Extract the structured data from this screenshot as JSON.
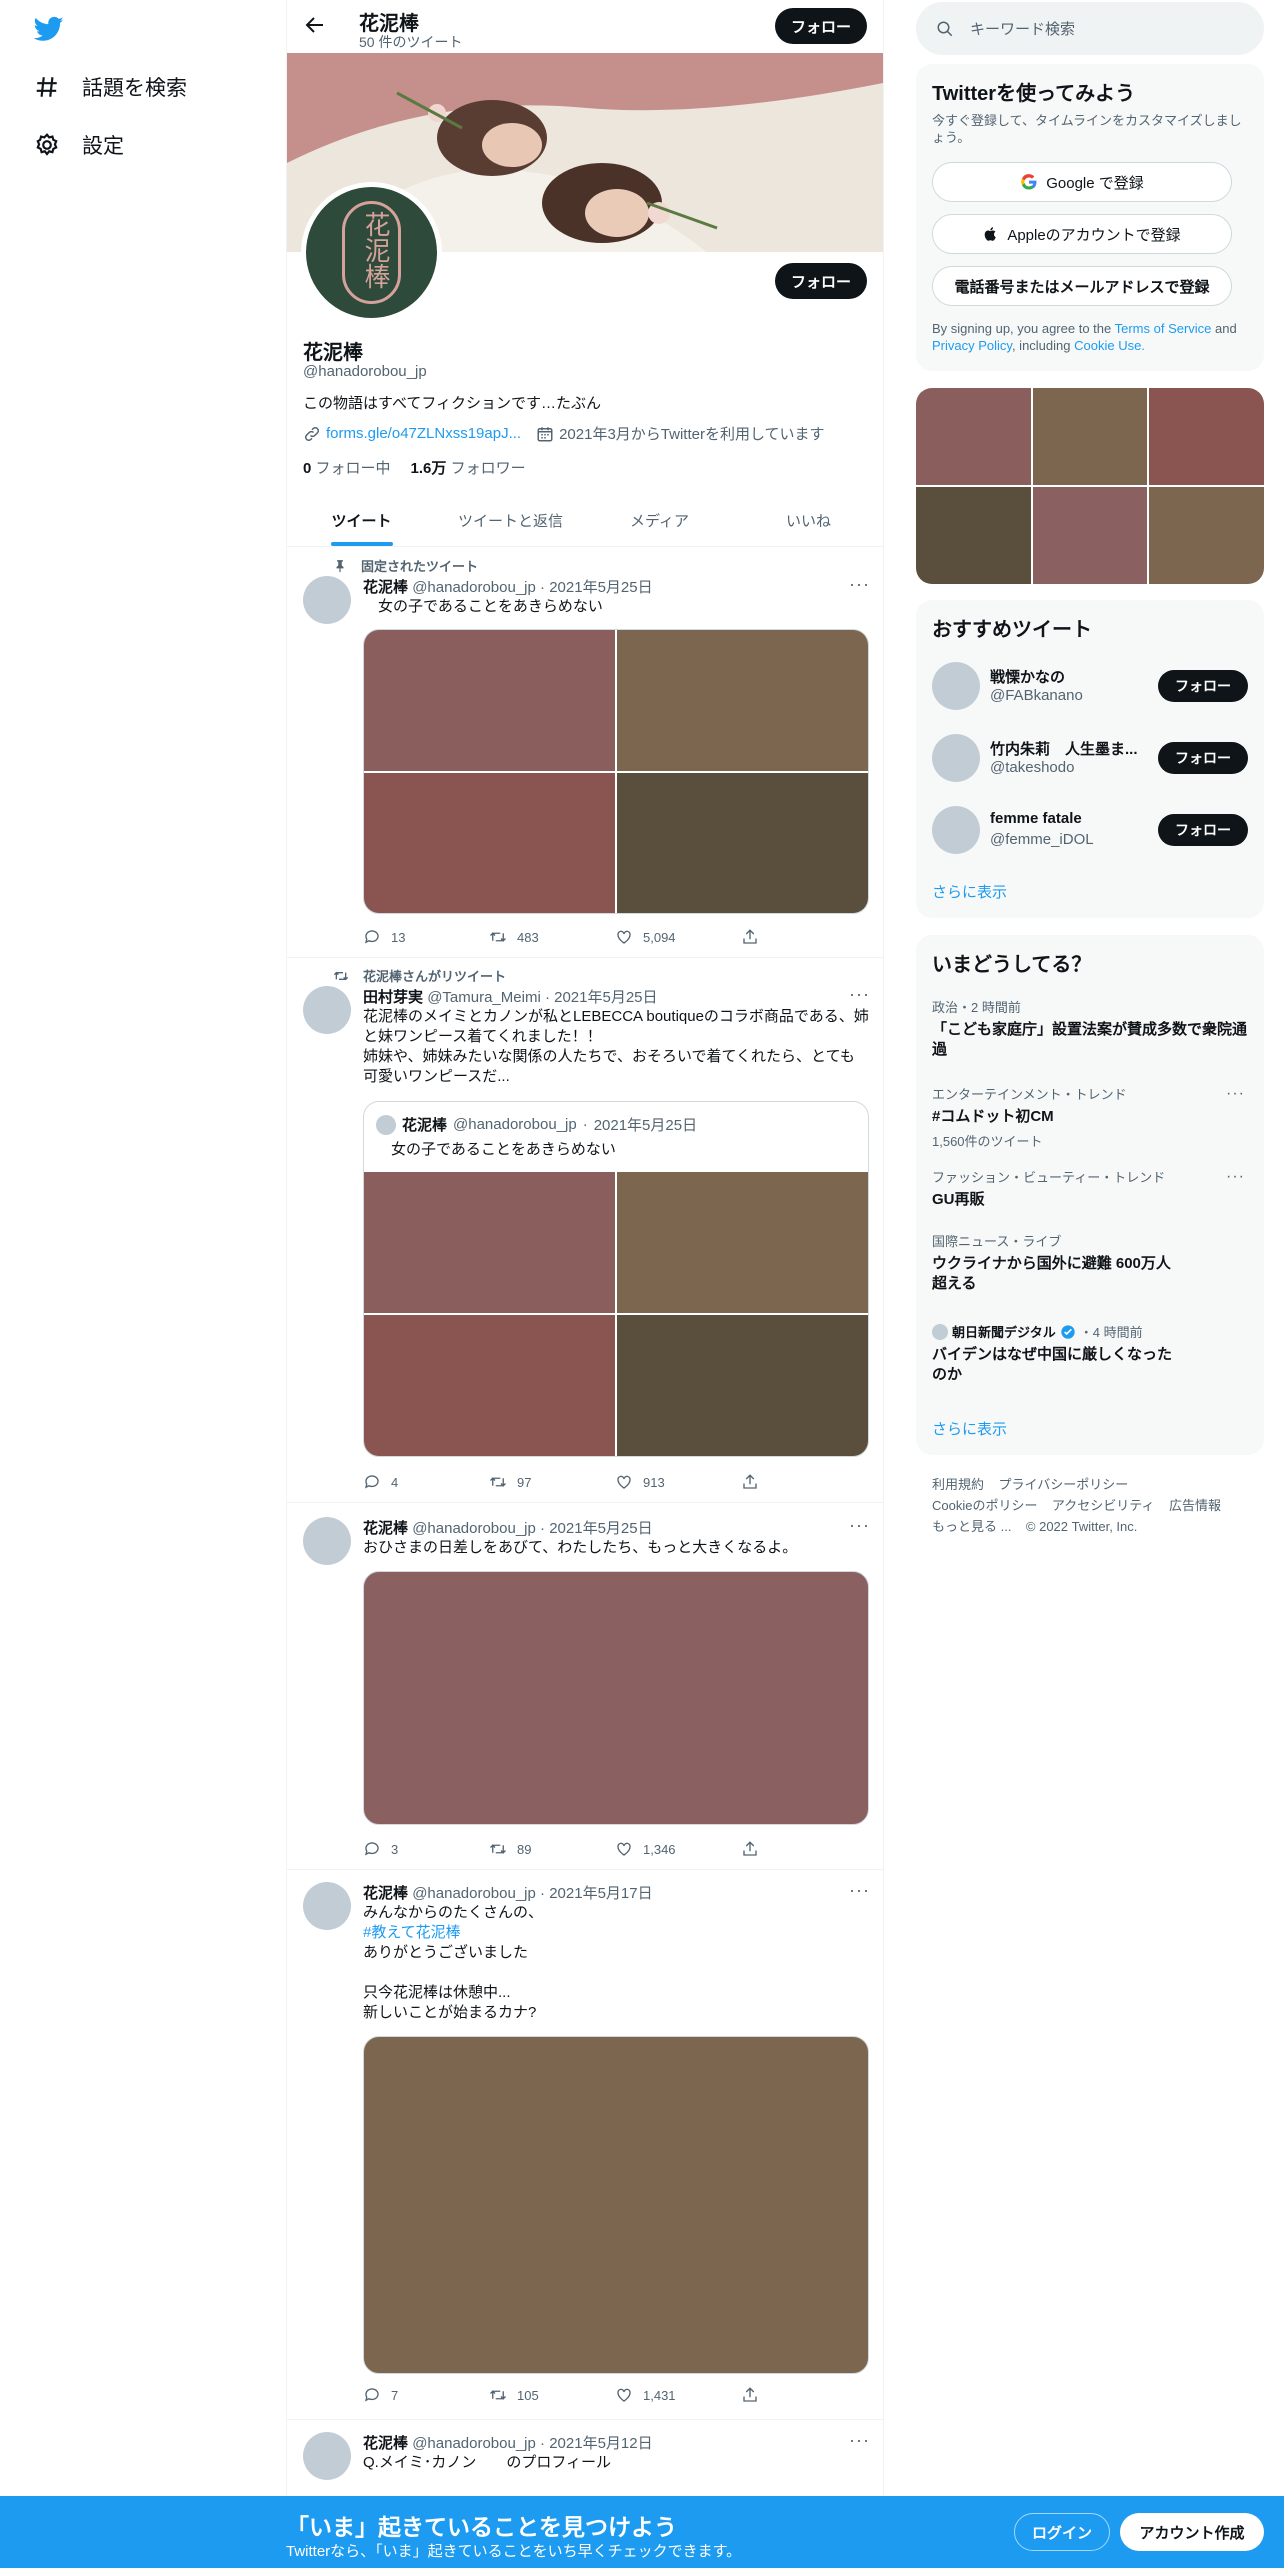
{
  "colors": {
    "accent": "#1d9bf0",
    "banner": "#c58f8b",
    "avatar_bg": "#2d4a3a"
  },
  "nav": {
    "logo": "twitter-bird-icon",
    "items": [
      {
        "label": "話題を検索",
        "icon": "hash-icon"
      },
      {
        "label": "設定",
        "icon": "gear-icon"
      }
    ]
  },
  "profile_header": {
    "name": "花泥棒",
    "tweet_count": "50 件のツイート",
    "follow_label": "フォロー"
  },
  "profile": {
    "avatar_text": "花泥棒",
    "follow_label": "フォロー",
    "name": "花泥棒",
    "handle": "@hanadorobou_jp",
    "bio": "この物語はすべてフィクションです…たぶん",
    "link": "forms.gle/o47ZLNxss19apJ...",
    "joined": "2021年3月からTwitterを利用しています",
    "following_count": "0",
    "following_label": "フォロー中",
    "followers_count": "1.6万",
    "followers_label": "フォロワー"
  },
  "tabs": [
    "ツイート",
    "ツイートと返信",
    "メディア",
    "いいね"
  ],
  "tweets": [
    {
      "context": "固定されたツイート",
      "name": "花泥棒",
      "handle": "@hanadorobou_jp",
      "date": "2021年5月25日",
      "text": "　女の子であることをあきらめない",
      "replies": "13",
      "retweets": "483",
      "likes": "5,094",
      "photos": [
        "#8b5e5e",
        "#7d6650",
        "#8a5550",
        "#5a4e3c"
      ]
    },
    {
      "context": "花泥棒さんがリツイート",
      "name": "田村芽実",
      "handle": "@Tamura_Meimi",
      "date": "2021年5月25日",
      "text": "花泥棒のメイミとカノンが私とLEBECCA boutiqueのコラボ商品である、姉と妹ワンピース着てくれました！！\n姉妹や、姉妹みたいな関係の人たちで、おそろいで着てくれたら、とても可愛いワンピースだ...",
      "quote": {
        "name": "花泥棒",
        "handle": "@hanadorobou_jp",
        "date": "2021年5月25日",
        "text": "　女の子であることをあきらめない"
      },
      "replies": "4",
      "retweets": "97",
      "likes": "913",
      "photos": [
        "#8b5e5e",
        "#7d6650",
        "#8a5550",
        "#5a4e3c"
      ]
    },
    {
      "name": "花泥棒",
      "handle": "@hanadorobou_jp",
      "date": "2021年5月25日",
      "text": "おひさまの日差しをあびて、わたしたち、もっと大きくなるよ。",
      "replies": "3",
      "retweets": "89",
      "likes": "1,346",
      "photos": [
        "#8a6060"
      ]
    },
    {
      "name": "花泥棒",
      "handle": "@hanadorobou_jp",
      "date": "2021年5月17日",
      "text_line1": "みんなからのたくさんの、",
      "hashtag": "#教えて花泥棒",
      "text_rest": "ありがとうございました\n\n只今花泥棒は休憩中...\n新しいことが始まるカナ?",
      "replies": "7",
      "retweets": "105",
      "likes": "1,431",
      "photos": [
        "#7d6650"
      ]
    },
    {
      "name": "花泥棒",
      "handle": "@hanadorobou_jp",
      "date": "2021年5月12日",
      "text": "Q.メイミ･カノン　　のプロフィール"
    }
  ],
  "search": {
    "placeholder": "キーワード検索"
  },
  "signup": {
    "title": "Twitterを使ってみよう",
    "subtitle": "今すぐ登録して、タイムラインをカスタマイズしましょう。",
    "google": "Google で登録",
    "apple": "Appleのアカウントで登録",
    "phone": "電話番号またはメールアドレスで登録",
    "terms_prefix": "By signing up, you agree to the ",
    "terms": "Terms of Service",
    "and": " and ",
    "privacy": "Privacy Policy",
    "including": ", including ",
    "cookie": "Cookie Use."
  },
  "media_grid": [
    "#8b5e5e",
    "#7d6650",
    "#8a5550",
    "#5a4e3c",
    "#8a6060",
    "#7d6650"
  ],
  "who_to_follow": {
    "title": "おすすめツイート",
    "users": [
      {
        "name": "戦慄かなの",
        "handle": "@FABkanano",
        "button": "フォロー"
      },
      {
        "name": "竹内朱莉　人生墨ま...",
        "handle": "@takeshodo",
        "button": "フォロー"
      },
      {
        "name": "femme fatale",
        "handle": "@femme_iDOL",
        "button": "フォロー"
      }
    ],
    "more": "さらに表示"
  },
  "trends": {
    "title": "いまどうしてる？",
    "items": [
      {
        "meta": "政治・2 時間前",
        "title": "「こども家庭庁」設置法案が賛成多数で衆院通過"
      },
      {
        "meta": "エンターテインメント・トレンド",
        "title": "#コムドット初CM",
        "count": "1,560件のツイート"
      },
      {
        "meta": "ファッション・ビューティー・トレンド",
        "title": "GU再販"
      },
      {
        "meta": "国際ニュース・ライブ",
        "title": "ウクライナから国外に避難 600万人超える"
      },
      {
        "source": "朝日新聞デジタル",
        "meta": "・4 時間前",
        "title": "バイデンはなぜ中国に厳しくなったのか"
      }
    ],
    "more": "さらに表示"
  },
  "footer": {
    "row1": [
      "利用規約",
      "プライバシーポリシー"
    ],
    "row2": [
      "Cookieのポリシー",
      "アクセシビリティ",
      "広告情報"
    ],
    "more": "もっと見る ...",
    "copyright": "© 2022 Twitter, Inc."
  },
  "bottom_bar": {
    "title": "「いま」起きていることを見つけよう",
    "subtitle": "Twitterなら、「いま」起きていることをいち早くチェックできます。",
    "login": "ログイン",
    "signup": "アカウント作成"
  }
}
